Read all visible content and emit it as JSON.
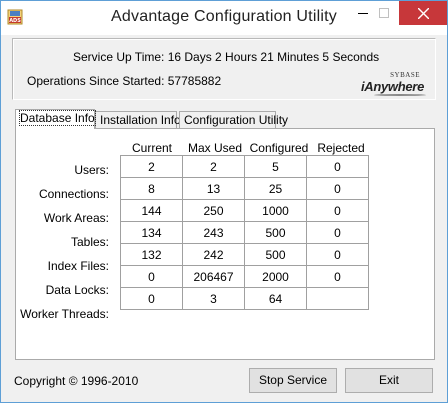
{
  "window": {
    "title": "Advantage Configuration Utility",
    "icon_label": "ADS"
  },
  "status": {
    "uptime": "Service Up Time: 16 Days 2 Hours 21 Minutes 5 Seconds",
    "operations": "Operations Since Started: 57785882"
  },
  "logo": {
    "line1": "SYBASE",
    "line2": "iAnywhere"
  },
  "tabs": [
    {
      "label": "Database Info",
      "active": true
    },
    {
      "label": "Installation Info",
      "active": false
    },
    {
      "label": "Configuration Utility",
      "active": false
    }
  ],
  "table": {
    "columns": [
      "Current",
      "Max Used",
      "Configured",
      "Rejected"
    ],
    "rows": [
      {
        "label": "Users:",
        "values": [
          "2",
          "2",
          "5",
          "0"
        ]
      },
      {
        "label": "Connections:",
        "values": [
          "8",
          "13",
          "25",
          "0"
        ]
      },
      {
        "label": "Work Areas:",
        "values": [
          "144",
          "250",
          "1000",
          "0"
        ]
      },
      {
        "label": "Tables:",
        "values": [
          "134",
          "243",
          "500",
          "0"
        ]
      },
      {
        "label": "Index Files:",
        "values": [
          "132",
          "242",
          "500",
          "0"
        ]
      },
      {
        "label": "Data Locks:",
        "values": [
          "0",
          "206467",
          "2000",
          "0"
        ]
      },
      {
        "label": "Worker Threads:",
        "values": [
          "0",
          "3",
          "64"
        ]
      }
    ]
  },
  "footer": {
    "copyright": "Copyright © 1996-2010",
    "stop_label": "Stop Service",
    "exit_label": "Exit"
  },
  "colors": {
    "close_button": "#c7373a",
    "window_border": "#5e9fd6"
  }
}
